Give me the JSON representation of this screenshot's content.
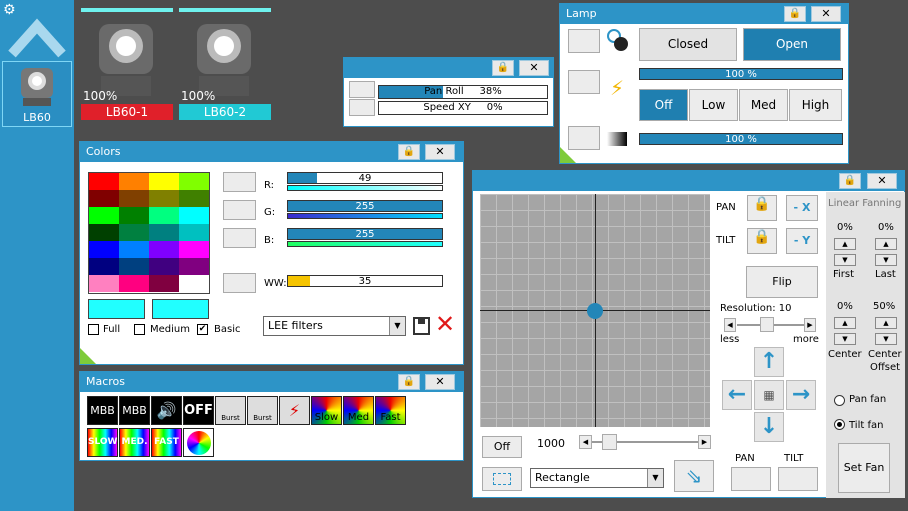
{
  "sidebar": {
    "gear_icon": "gear-icon",
    "selected_device": "LB60"
  },
  "fixtures": [
    {
      "pct": "100%",
      "name": "LB60-1",
      "color": "#e0202a",
      "text": "#fff"
    },
    {
      "pct": "100%",
      "name": "LB60-2",
      "color": "#21c9d4",
      "text": "#fff"
    }
  ],
  "pantilt": {
    "pan_roll": "Pan Roll",
    "pan_roll_value": "38%",
    "speed": "Speed XY",
    "speed_value": "0%"
  },
  "lamp": {
    "title": "Lamp",
    "closed": "Closed",
    "open": "Open",
    "intensity1": "100 %",
    "off": "Off",
    "low": "Low",
    "med": "Med",
    "high": "High",
    "intensity2": "100 %"
  },
  "colors": {
    "title": "Colors",
    "r_label": "R:",
    "r_value": "49",
    "g_label": "G:",
    "g_value": "255",
    "b_label": "B:",
    "b_value": "255",
    "ww_label": "WW:",
    "ww_value": "35",
    "full": "Full",
    "medium": "Medium",
    "basic": "Basic",
    "filter": "LEE filters",
    "palette": [
      "#ff0000",
      "#ff8000",
      "#ffff00",
      "#80ff00",
      "#800000",
      "#804000",
      "#808000",
      "#408000",
      "#00ff00",
      "#008000",
      "#00ff80",
      "#00ffff",
      "#004000",
      "#008040",
      "#008080",
      "#00c0c0",
      "#0000ff",
      "#0080ff",
      "#8000ff",
      "#ff00ff",
      "#000080",
      "#004080",
      "#400080",
      "#800080",
      "#ff80c0",
      "#ff0080",
      "#800040",
      "#ffffff"
    ],
    "swatch1": "#21ffff",
    "swatch2": "#21ffff"
  },
  "macros": {
    "title": "Macros",
    "labels": [
      "MBB",
      "MBB",
      "Burst",
      "Burst",
      "Slow",
      "Med",
      "Fast",
      "SLOW",
      "MED.",
      "FAST"
    ]
  },
  "position": {
    "pan": "PAN",
    "tilt": "TILT",
    "minus_x": "- X",
    "minus_y": "- Y",
    "flip": "Flip",
    "resolution": "Resolution: 10",
    "less": "less",
    "more": "more",
    "off": "Off",
    "speed_value": "1000",
    "shape": "Rectangle",
    "pan_bottom": "PAN",
    "tilt_bottom": "TILT",
    "dot_x": 0.5,
    "dot_y": 0.5
  },
  "fanning": {
    "title": "Linear Fanning",
    "first_value": "0%",
    "last_value": "0%",
    "first": "First",
    "last": "Last",
    "center_value": "0%",
    "offset_value": "50%",
    "center": "Center",
    "center_offset_1": "Center",
    "center_offset_2": "Offset",
    "pan_fan": "Pan fan",
    "tilt_fan": "Tilt fan",
    "set_fan": "Set Fan"
  }
}
